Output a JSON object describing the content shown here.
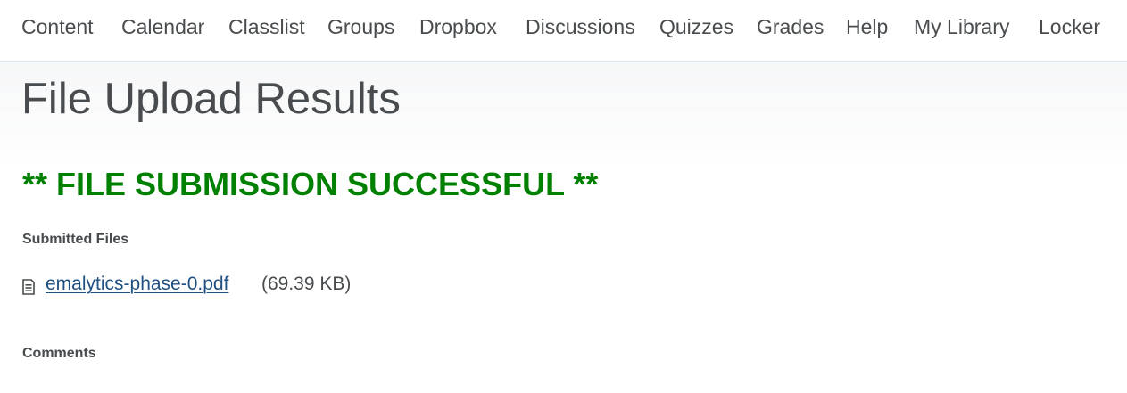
{
  "nav": {
    "items": [
      {
        "label": "Content"
      },
      {
        "label": "Calendar"
      },
      {
        "label": "Classlist"
      },
      {
        "label": "Groups"
      },
      {
        "label": "Dropbox"
      },
      {
        "label": "Discussions"
      },
      {
        "label": "Quizzes"
      },
      {
        "label": "Grades"
      },
      {
        "label": "Help"
      },
      {
        "label": "My Library"
      },
      {
        "label": "Locker"
      }
    ]
  },
  "page": {
    "title": "File Upload Results",
    "success_message": "** FILE SUBMISSION SUCCESSFUL **",
    "submitted_files_label": "Submitted Files",
    "files": [
      {
        "name": "emalytics-phase-0.pdf",
        "size": "(69.39 KB)",
        "icon": "document-icon"
      }
    ],
    "comments_label": "Comments"
  },
  "colors": {
    "text": "#494c4e",
    "success": "#008000",
    "link": "#205182"
  }
}
